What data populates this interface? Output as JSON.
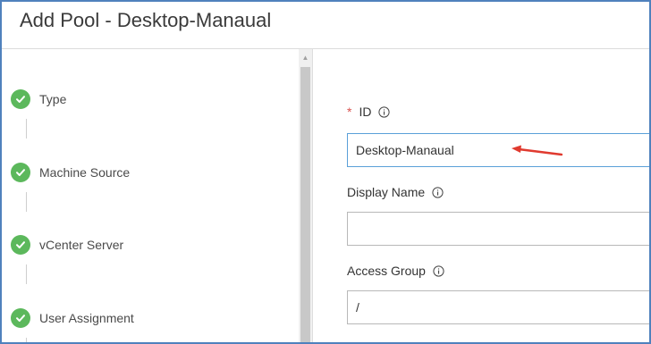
{
  "dialog": {
    "title": "Add Pool - Desktop-Manaual"
  },
  "wizard_steps": [
    {
      "label": "Type",
      "status": "complete",
      "icon": "checkmark-icon"
    },
    {
      "label": "Machine Source",
      "status": "complete",
      "icon": "checkmark-icon"
    },
    {
      "label": "vCenter Server",
      "status": "complete",
      "icon": "checkmark-icon"
    },
    {
      "label": "User Assignment",
      "status": "complete",
      "icon": "checkmark-icon"
    }
  ],
  "form": {
    "id": {
      "required_marker": "*",
      "label": "ID",
      "value": "Desktop-Manaual",
      "info_icon": "info-icon"
    },
    "display_name": {
      "label": "Display Name",
      "value": "",
      "info_icon": "info-icon"
    },
    "access_group": {
      "label": "Access Group",
      "value": "/",
      "info_icon": "info-icon"
    }
  },
  "annotation": {
    "type": "red-arrow",
    "color": "#e03a2f"
  },
  "colors": {
    "step_complete": "#5cb85c",
    "required": "#d9534f",
    "focus_border": "#5aa0d8",
    "window_border": "#4f81bd"
  }
}
